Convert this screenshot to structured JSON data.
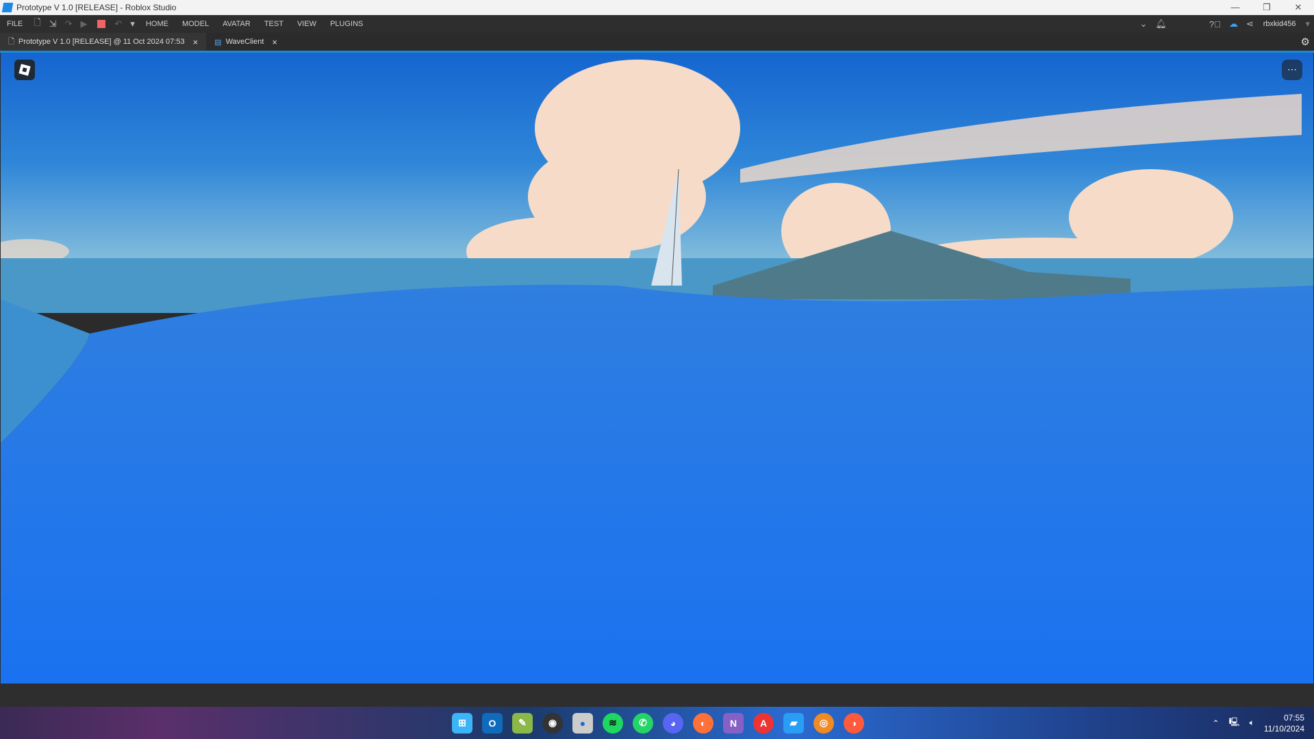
{
  "window": {
    "title": "Prototype V 1.0 [RELEASE] - Roblox Studio",
    "minimize": "—",
    "restore": "❐",
    "close": "✕"
  },
  "menu": {
    "file": "FILE",
    "items": [
      "HOME",
      "MODEL",
      "AVATAR",
      "TEST",
      "VIEW",
      "PLUGINS"
    ],
    "username": "rbxkid456"
  },
  "tabs": [
    {
      "label": "Prototype V 1.0 [RELEASE] @ 11 Oct 2024 07:53",
      "close": "×"
    },
    {
      "label": "WaveClient",
      "close": "×"
    }
  ],
  "viewport": {
    "more_icon": "⋯"
  },
  "taskbar": {
    "apps": [
      "start",
      "outlook",
      "notepad",
      "obs",
      "app",
      "spotify",
      "whatsapp",
      "discord",
      "firefox",
      "visual-studio",
      "app2",
      "app3",
      "blender",
      "firefox-dev"
    ],
    "time": "07:55",
    "date": "11/10/2024"
  },
  "colors": {
    "accent": "#1b8ad6",
    "stop": "#f06464"
  }
}
